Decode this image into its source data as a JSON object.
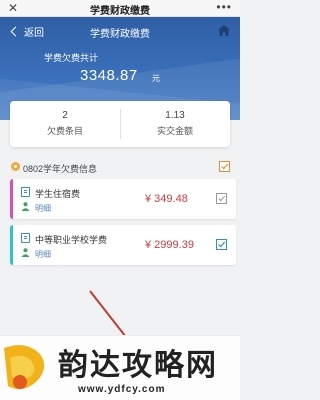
{
  "system_bar": {
    "close_icon": "✕",
    "title": "学费财政缴费",
    "more_icon": "•••"
  },
  "nav": {
    "back_label": "返回",
    "title": "学费财政缴费"
  },
  "summary": {
    "owed_label": "学费欠费共计",
    "owed_amount": "3348.87",
    "owed_unit": "元"
  },
  "stats": [
    {
      "value": "2",
      "label": "欠费条目"
    },
    {
      "value": "1.13",
      "label": "实交金额"
    }
  ],
  "section": {
    "title": "0802学年欠费信息"
  },
  "fees": [
    {
      "name": "学生住宿费",
      "detail": "明细",
      "amount": "¥ 349.48",
      "accent": "#d94fb7",
      "checked": false
    },
    {
      "name": "中等职业学校学费",
      "detail": "明细",
      "amount": "¥ 2999.39",
      "accent": "#2cc4c4",
      "checked": true
    }
  ],
  "watermark": {
    "brand": "韵达攻略网",
    "url": "www.ydfcy.com"
  },
  "colors": {
    "header_blue": "#3a6fb9",
    "amount_red": "#d03a3a",
    "accent_orange": "#f2a93b"
  }
}
